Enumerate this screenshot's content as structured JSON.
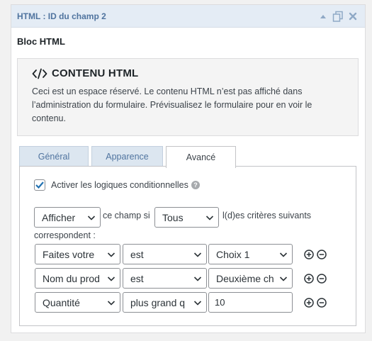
{
  "panel": {
    "title": "HTML : ID du champ 2",
    "icons": [
      "collapse-arrow-icon",
      "duplicate-icon",
      "delete-icon"
    ]
  },
  "field": {
    "label": "Bloc HTML"
  },
  "placeholder": {
    "title": "CONTENU HTML",
    "text": "Ceci est un espace réservé. Le contenu HTML n’est pas affiché dans l’administration du formulaire. Prévisualisez le formulaire pour en voir le contenu."
  },
  "tabs": [
    {
      "label": "Général",
      "active": false
    },
    {
      "label": "Apparence",
      "active": false
    },
    {
      "label": "Avancé",
      "active": true
    }
  ],
  "conditional": {
    "checkbox_label": "Activer les logiques conditionnelles",
    "checked": true,
    "action": "Afficher",
    "text_middle": "ce champ si",
    "logic": "Tous",
    "text_after": "l(d)es critères suivants",
    "text_end": "correspondent :"
  },
  "rules": [
    {
      "field": "Faites votre",
      "operator": "est",
      "value": "Choix 1",
      "value_type": "select"
    },
    {
      "field": "Nom du prod",
      "operator": "est",
      "value": "Deuxième ch",
      "value_type": "select"
    },
    {
      "field": "Quantité",
      "operator": "plus grand q",
      "value": "10",
      "value_type": "input"
    }
  ],
  "colors": {
    "accent": "#2271b1",
    "header_bg": "#e4ecf5",
    "header_text": "#50749f",
    "tab_bg": "#dce6f0"
  }
}
